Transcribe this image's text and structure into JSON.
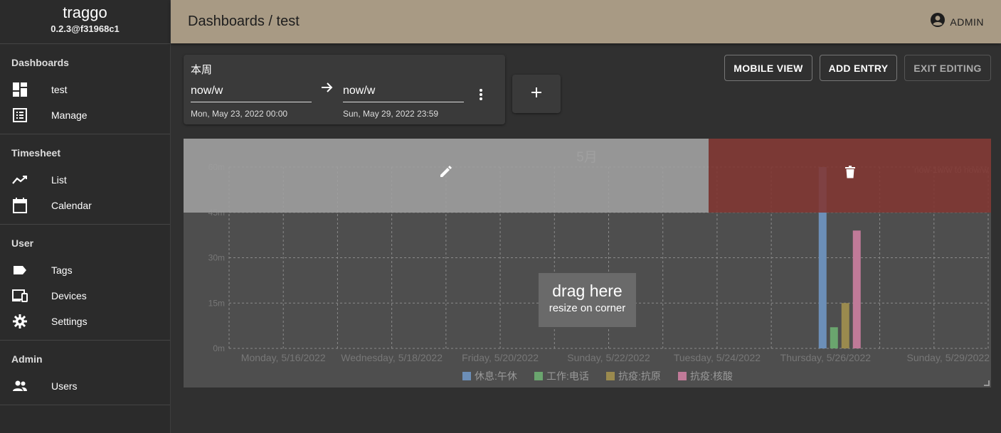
{
  "app": {
    "name": "traggo",
    "version": "0.2.3@f31968c1"
  },
  "sidebar": {
    "sections": [
      {
        "title": "Dashboards",
        "items": [
          {
            "label": "test",
            "icon": "dashboard-icon"
          },
          {
            "label": "Manage",
            "icon": "list-icon"
          }
        ]
      },
      {
        "title": "Timesheet",
        "items": [
          {
            "label": "List",
            "icon": "trending-icon"
          },
          {
            "label": "Calendar",
            "icon": "calendar-icon"
          }
        ]
      },
      {
        "title": "User",
        "items": [
          {
            "label": "Tags",
            "icon": "tag-icon"
          },
          {
            "label": "Devices",
            "icon": "devices-icon"
          },
          {
            "label": "Settings",
            "icon": "gear-icon"
          }
        ]
      },
      {
        "title": "Admin",
        "items": [
          {
            "label": "Users",
            "icon": "users-icon"
          }
        ]
      }
    ]
  },
  "header": {
    "title": "Dashboards / test",
    "user": "ADMIN"
  },
  "range": {
    "name": "本周",
    "from": "now/w",
    "to": "now/w",
    "from_resolved": "Mon, May 23, 2022 00:00",
    "to_resolved": "Sun, May 29, 2022 23:59"
  },
  "toolbar": {
    "mobile_view": "MOBILE VIEW",
    "add_entry": "ADD ENTRY",
    "exit_editing": "EXIT EDITING"
  },
  "entry_overlay": {
    "drag_title": "drag here",
    "drag_sub": "resize on corner"
  },
  "colors": {
    "header": "#a89a84",
    "sidebar": "#2b2b2b",
    "background": "#303030",
    "delete_zone": "#823732"
  },
  "chart_data": {
    "type": "bar",
    "title": "5月",
    "range_label": "now-1w/w to now/w",
    "y_ticks": [
      "0m",
      "15m",
      "30m",
      "45m",
      "60m"
    ],
    "ylim": [
      0,
      60
    ],
    "x_ticks": [
      "Monday, 5/16/2022",
      "Wednesday, 5/18/2022",
      "Friday, 5/20/2022",
      "Sunday, 5/22/2022",
      "Tuesday, 5/24/2022",
      "Thursday, 5/26/2022",
      "Sunday, 5/29/2022"
    ],
    "x_tick_dates": [
      "2022-05-16",
      "2022-05-18",
      "2022-05-20",
      "2022-05-22",
      "2022-05-24",
      "2022-05-26",
      "2022-05-29"
    ],
    "x_range": [
      "2022-05-15",
      "2022-05-29"
    ],
    "grid": true,
    "legend_position": "bottom",
    "series": [
      {
        "name": "休息:午休",
        "color": "#6c8fb8",
        "date": "2022-05-26",
        "value": 60
      },
      {
        "name": "工作:电话",
        "color": "#6aa56e",
        "date": "2022-05-26",
        "value": 7
      },
      {
        "name": "抗疫:抗原",
        "color": "#9a8a4e",
        "date": "2022-05-26",
        "value": 15
      },
      {
        "name": "抗疫:核酸",
        "color": "#c07a98",
        "date": "2022-05-26",
        "value": 39
      }
    ]
  }
}
